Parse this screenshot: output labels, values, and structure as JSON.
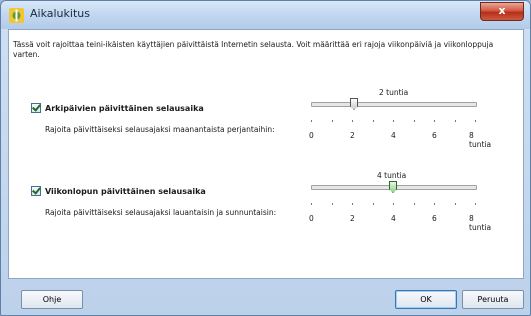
{
  "window": {
    "title": "Aikalukitus",
    "close_label": "x"
  },
  "intro_text": "Tässä voit rajoittaa teini-ikäisten käyttäjien päivittäistä Internetin selausta. Voit määrittää eri rajoja viikonpäiviä ja viikonloppuja varten.",
  "weekdays": {
    "checkbox_label": "Arkipäivien päivittäinen selausaika",
    "description": "Rajoita päivittäiseksi selausajaksi maanantaista perjantaihin:",
    "value_label": "2 tuntia",
    "value": 2,
    "min": 0,
    "max": 8
  },
  "weekend": {
    "checkbox_label": "Viikonlopun päivittäinen selausaika",
    "description": "Rajoita päivittäiseksi selausajaksi lauantaisin ja sunnuntaisin:",
    "value_label": "4 tuntia",
    "value": 4,
    "min": 0,
    "max": 8
  },
  "ticks": [
    "0",
    "2",
    "4",
    "6",
    "8 tuntia"
  ],
  "buttons": {
    "help": "Ohje",
    "ok": "OK",
    "cancel": "Peruuta"
  }
}
